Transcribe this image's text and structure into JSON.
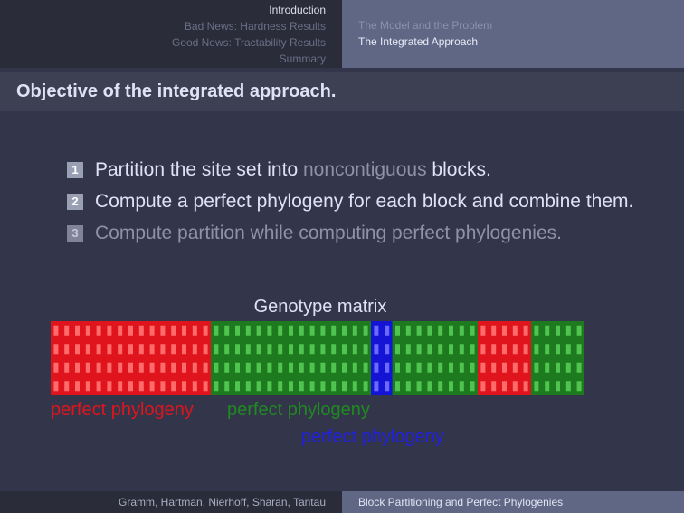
{
  "nav": {
    "sections": [
      "Introduction",
      "Bad News: Hardness Results",
      "Good News: Tractability Results",
      "Summary"
    ],
    "subsections": [
      "The Model and the Problem",
      "The Integrated Approach"
    ]
  },
  "frame_title": "Objective of the integrated approach.",
  "list": {
    "item1": {
      "num": "1",
      "pre": "Partition the site set into ",
      "dim": "noncontiguous",
      "post": " blocks."
    },
    "item2": {
      "num": "2",
      "text": "Compute a perfect phylogeny for each block and combine them."
    },
    "item3": {
      "num": "3",
      "text": "Compute partition while computing perfect phylogenies."
    }
  },
  "matrix": {
    "title": "Genotype matrix",
    "rows": 4,
    "blocks": [
      {
        "color": "red",
        "columns": 15
      },
      {
        "color": "green",
        "columns": 15
      },
      {
        "color": "blue",
        "columns": 2
      },
      {
        "color": "green",
        "columns": 8
      },
      {
        "color": "red",
        "columns": 5
      },
      {
        "color": "green",
        "columns": 5
      }
    ],
    "colors": {
      "red": {
        "bg": "#e0141c",
        "cell": "#ff6a6a"
      },
      "green": {
        "bg": "#1e7a1e",
        "cell": "#4fc44f"
      },
      "blue": {
        "bg": "#1414d4",
        "cell": "#6a6aff"
      }
    }
  },
  "labels": {
    "red": "perfect phylogeny",
    "green": "perfect phylogeny",
    "blue": "perfect phylogeny"
  },
  "footer": {
    "authors": "Gramm, Hartman, Nierhoff, Sharan, Tantau",
    "title": "Block Partitioning and Perfect Phylogenies"
  }
}
